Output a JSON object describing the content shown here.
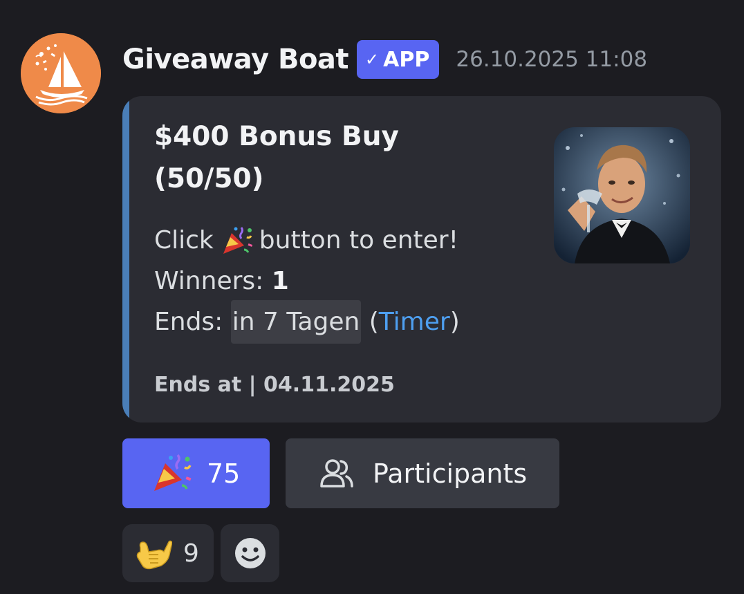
{
  "author": {
    "username": "Giveaway Boat",
    "badge_label": "APP",
    "badge_check": "✓",
    "timestamp": "26.10.2025 11:08",
    "avatar_icon": "sailboat-confetti-icon",
    "avatar_color": "#ef8a49"
  },
  "embed": {
    "title": "$400 Bonus Buy\n(50/50)",
    "description": {
      "line1_before": "Click",
      "line1_emoji": "party-popper-icon",
      "line1_after": "button to enter!",
      "winners_label": "Winners:",
      "winners_value": "1",
      "ends_label": "Ends:",
      "ends_relative": "in 7 Tagen",
      "timer_open": "(",
      "timer_link": "Timer",
      "timer_close": ")"
    },
    "footer": "Ends at | 04.11.2025",
    "accent_color": "#4a7eb8",
    "thumbnail": "toasting-man-gif"
  },
  "buttons": {
    "enter_icon": "party-popper-icon",
    "enter_count": "75",
    "participants_icon": "users-icon",
    "participants_label": "Participants",
    "enter_color": "#5865f2"
  },
  "reactions": [
    {
      "emoji": "call-me-hand-icon",
      "count": "9"
    },
    {
      "emoji": "add-reaction-smile-icon"
    }
  ]
}
